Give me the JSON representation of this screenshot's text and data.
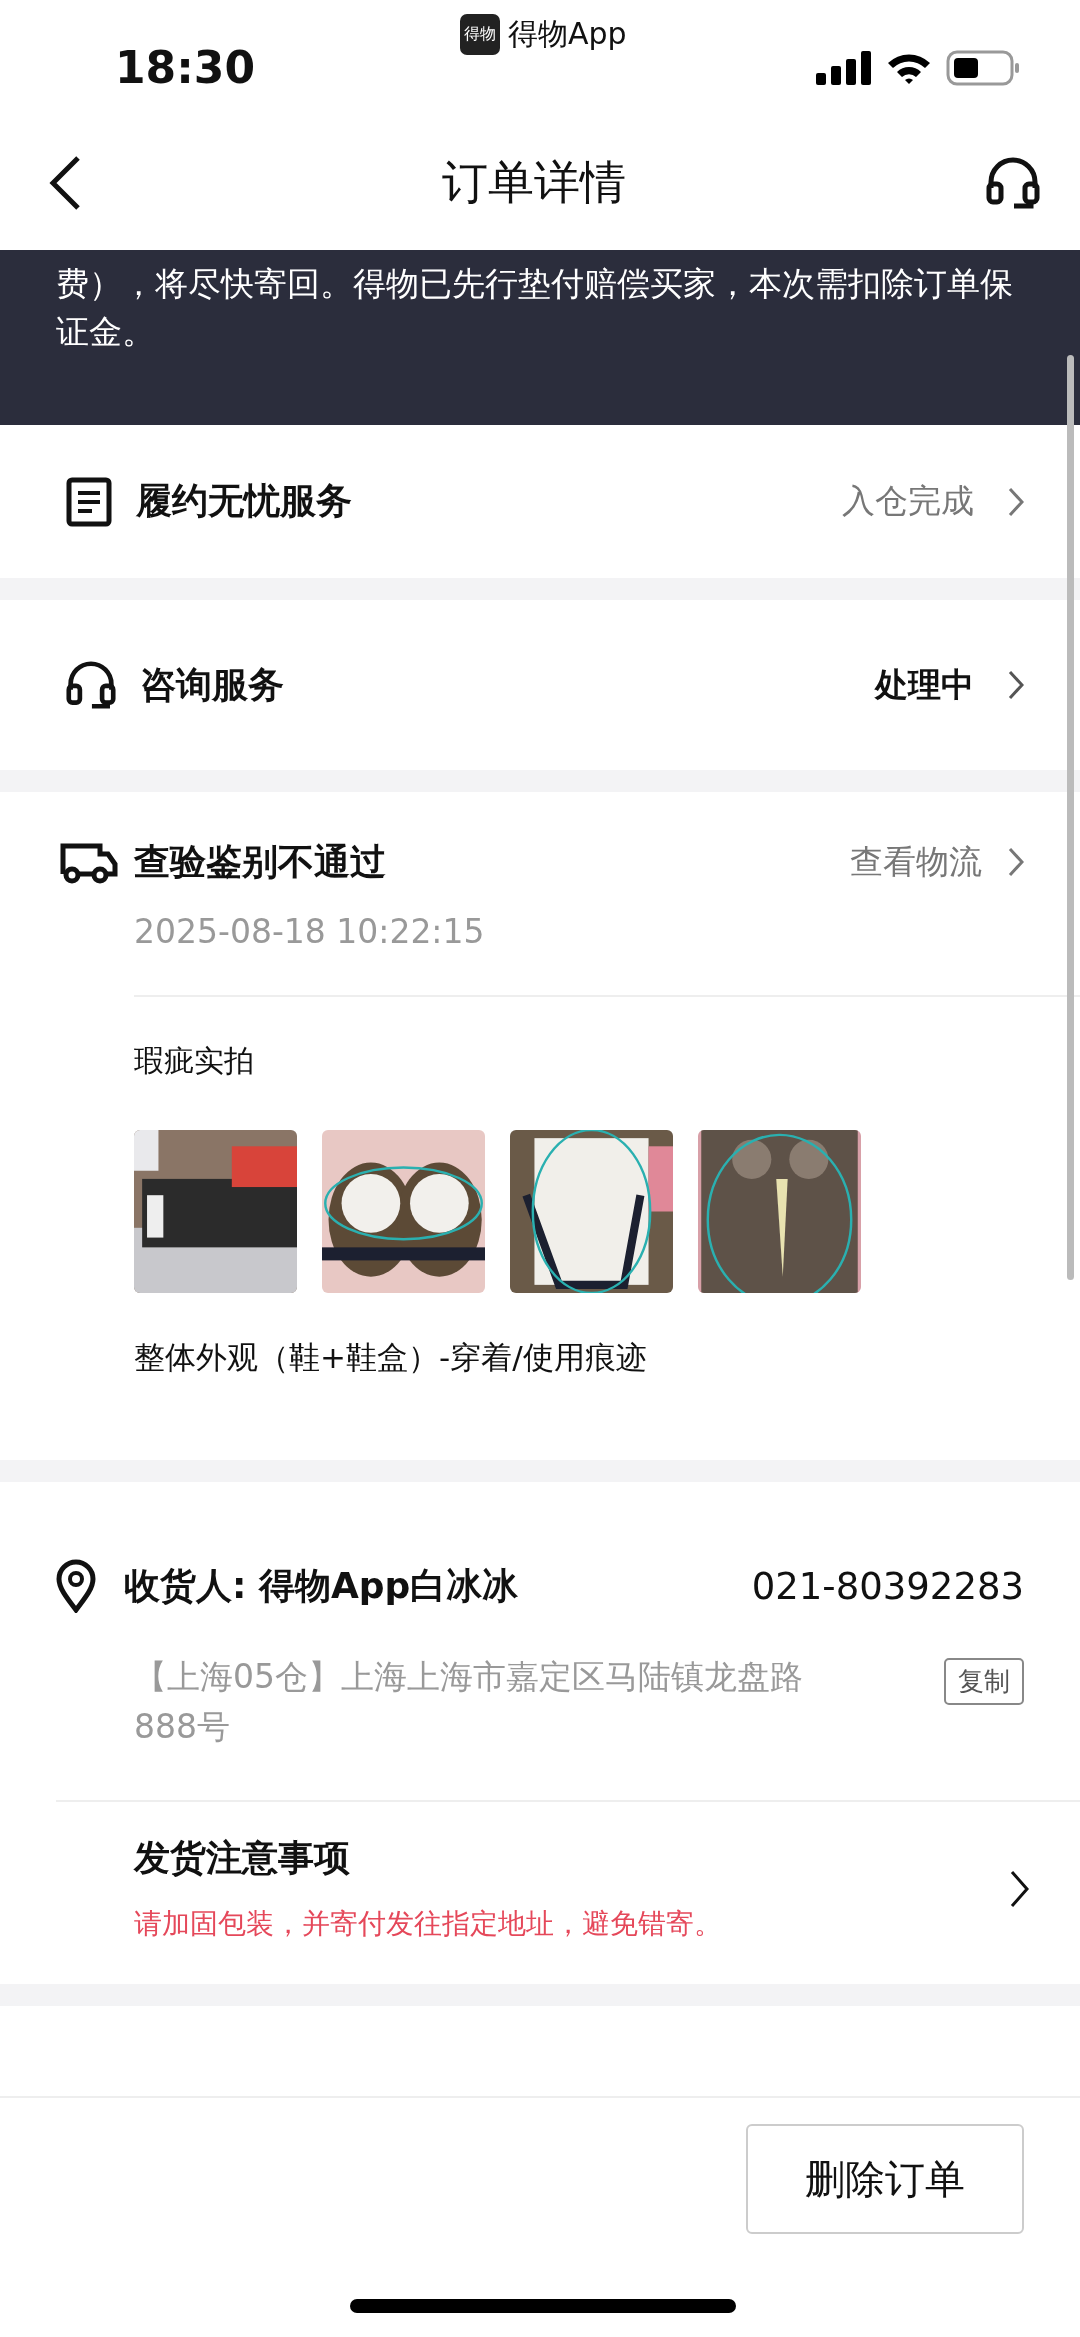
{
  "status_bar": {
    "time": "18:30",
    "app_badge": "得物",
    "app_label": "得物App"
  },
  "header": {
    "title": "订单详情"
  },
  "banner": {
    "text": "费），将尽快寄回。得物已先行垫付赔偿买家，本次需扣除订单保证金。"
  },
  "service_rows": [
    {
      "kind": "document",
      "title": "履约无忧服务",
      "status": "入仓完成",
      "highlighted": false
    },
    {
      "kind": "headset",
      "title": "咨询服务",
      "status": "处理中",
      "highlighted": true
    }
  ],
  "inspection": {
    "title": "查验鉴别不通过",
    "link": "查看物流",
    "time": "2025-08-18 10:22:15",
    "defect_label": "瑕疵实拍",
    "caption": "整体外观（鞋+鞋盒）-穿着/使用痕迹"
  },
  "address": {
    "consignee": "收货人: 得物App白冰冰",
    "phone": "021-80392283",
    "address": "【上海05仓】上海上海市嘉定区马陆镇龙盘路888号",
    "copy_button": "复制",
    "notice_title": "发货注意事项",
    "notice_text": "请加固包装，并寄付发往指定地址，避免错寄。"
  },
  "footer": {
    "button": "删除订单"
  }
}
